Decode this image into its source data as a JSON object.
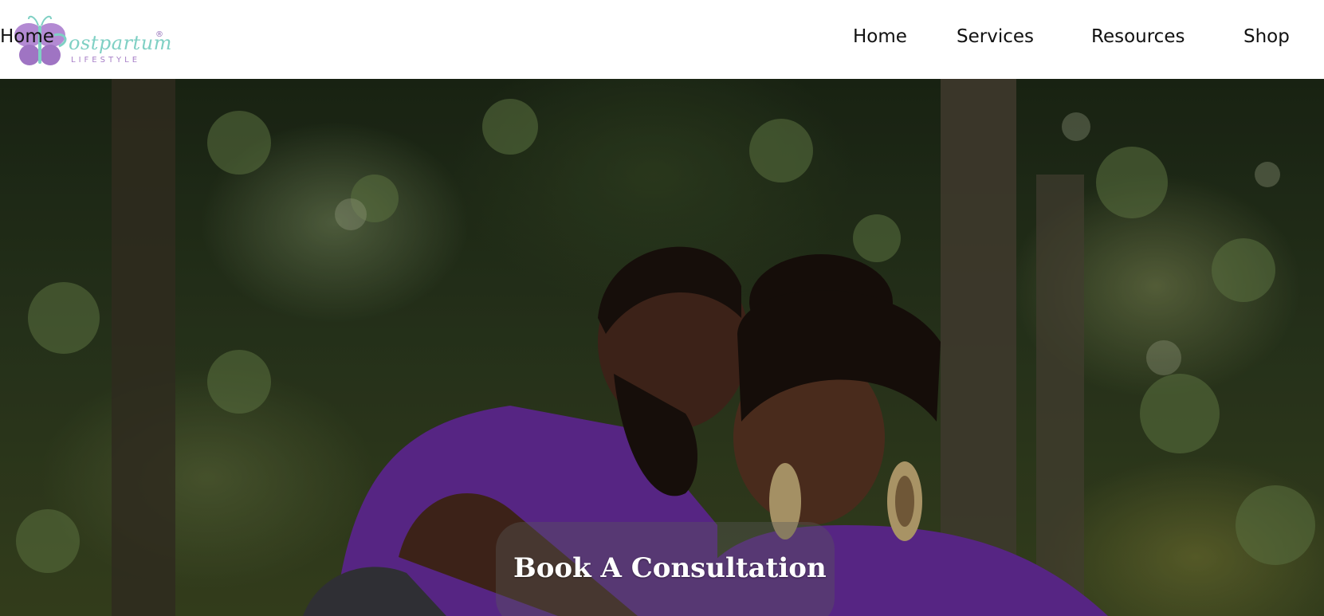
{
  "brand": {
    "logo_word": "ostpartum",
    "logo_initial": "P",
    "logo_sub": "LIFESTYLE",
    "registered_mark": "®",
    "colors": {
      "teal": "#7fd0c4",
      "lavender": "#a77fc7"
    }
  },
  "nav": {
    "items": [
      {
        "label": "Home"
      },
      {
        "label": "Services"
      },
      {
        "label": "Resources"
      },
      {
        "label": "Shop"
      }
    ]
  },
  "hero": {
    "cta_label": "Book A Consultation",
    "shirt_color": "#6a2ea0"
  }
}
